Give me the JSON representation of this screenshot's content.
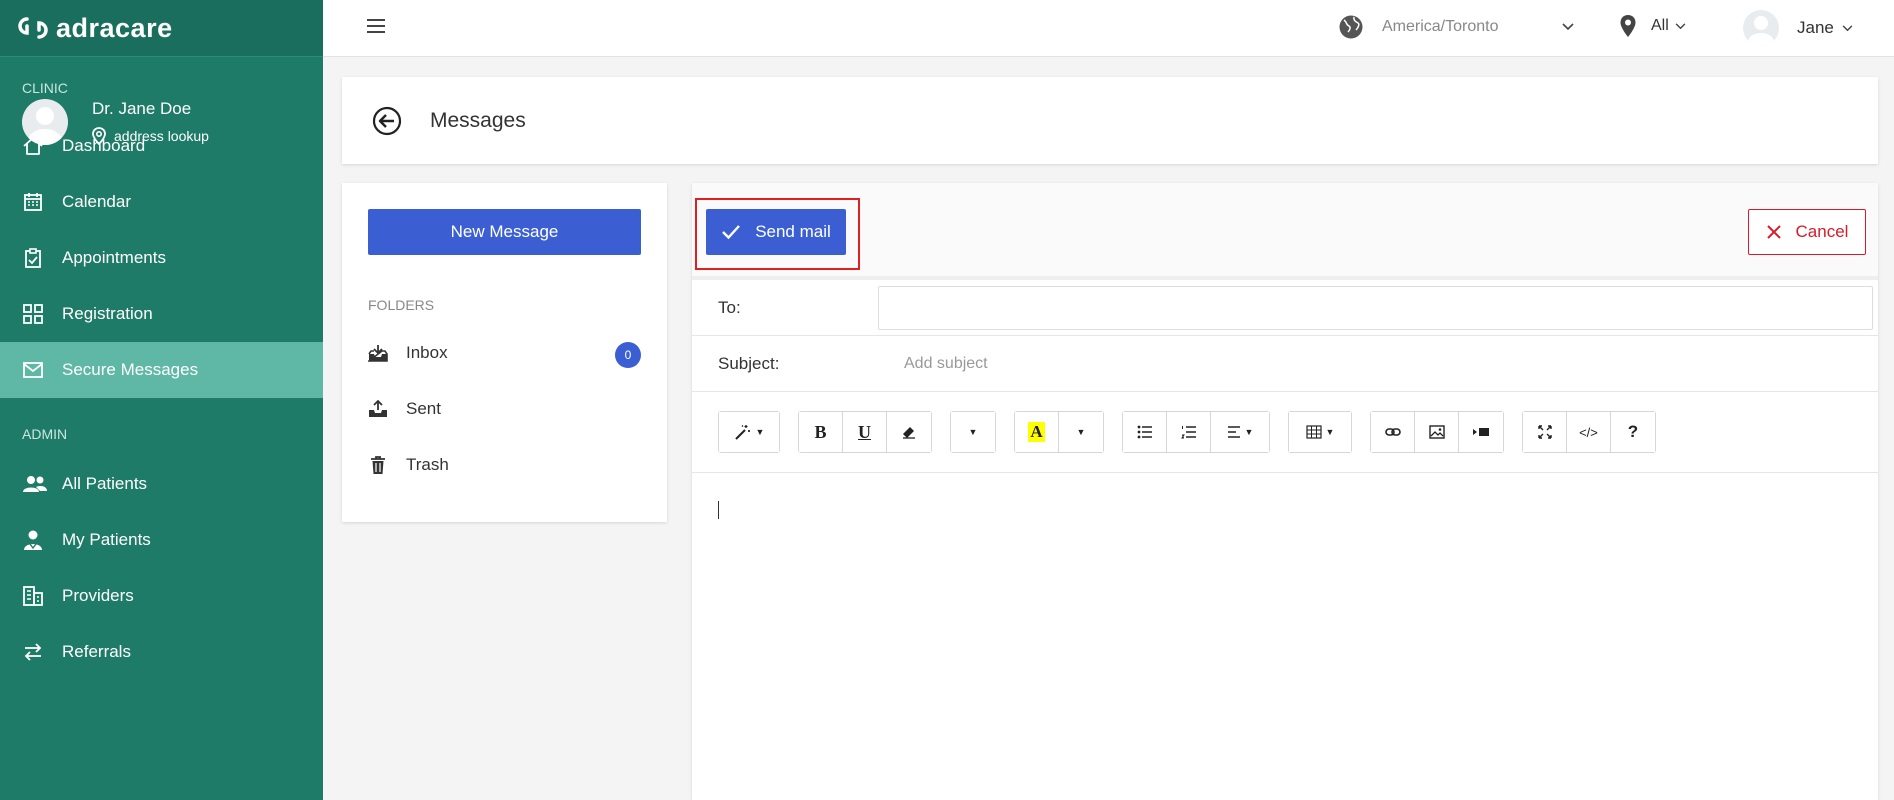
{
  "brand": {
    "name": "adracare"
  },
  "profile": {
    "name": "Dr. Jane Doe",
    "address": "address lookup"
  },
  "sidebar": {
    "clinic_label": "CLINIC",
    "admin_label": "ADMIN",
    "clinic_items": [
      {
        "label": "Dashboard"
      },
      {
        "label": "Calendar"
      },
      {
        "label": "Appointments"
      },
      {
        "label": "Registration"
      },
      {
        "label": "Secure Messages"
      }
    ],
    "admin_items": [
      {
        "label": "All Patients"
      },
      {
        "label": "My Patients"
      },
      {
        "label": "Providers"
      },
      {
        "label": "Referrals"
      }
    ]
  },
  "topbar": {
    "timezone": "America/Toronto",
    "location": "All",
    "user": "Jane"
  },
  "page": {
    "title": "Messages"
  },
  "folders": {
    "new_message_label": "New Message",
    "section_label": "FOLDERS",
    "items": [
      {
        "label": "Inbox",
        "count": "0"
      },
      {
        "label": "Sent"
      },
      {
        "label": "Trash"
      }
    ]
  },
  "compose": {
    "send_label": "Send mail",
    "cancel_label": "Cancel",
    "to_label": "To:",
    "to_value": "",
    "subject_label": "Subject:",
    "subject_placeholder": "Add subject",
    "toolbar": {
      "bold": "B",
      "underline": "U",
      "highlight": "A",
      "code": "</>",
      "help": "?"
    }
  },
  "colors": {
    "sidebar_bg": "#1e7b68",
    "sidebar_active": "#5fb8a5",
    "primary": "#3b5fd3",
    "danger": "#d91a2a"
  }
}
